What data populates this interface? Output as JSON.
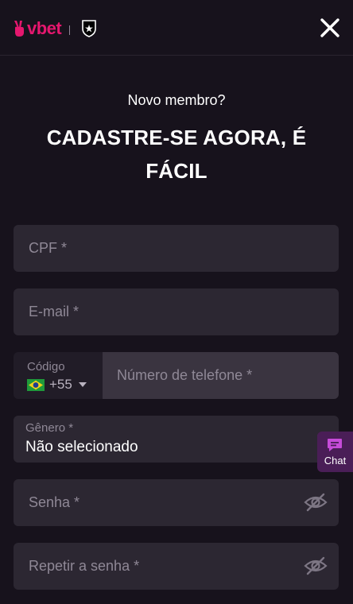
{
  "header": {
    "logo_text": "vbet",
    "logo_icon": "victory-hand-icon",
    "partner_icon": "botafogo-shield-icon",
    "close_icon": "close-icon"
  },
  "form": {
    "subtitle": "Novo membro?",
    "title": "CADASTRE-SE AGORA, É FÁCIL",
    "cpf_placeholder": "CPF *",
    "email_placeholder": "E-mail *",
    "code_label": "Código",
    "code_value": "+55",
    "code_flag": "brazil-flag-icon",
    "phone_placeholder": "Número de telefone *",
    "gender_label": "Gênero *",
    "gender_value": "Não selecionado",
    "password_placeholder": "Senha *",
    "repeat_password_placeholder": "Repetir a senha *"
  },
  "chat": {
    "label": "Chat",
    "icon": "chat-bubble-icon"
  },
  "colors": {
    "brand": "#e5176e",
    "background": "#17121c",
    "field": "#2c2732",
    "chat": "#4a1e57"
  }
}
